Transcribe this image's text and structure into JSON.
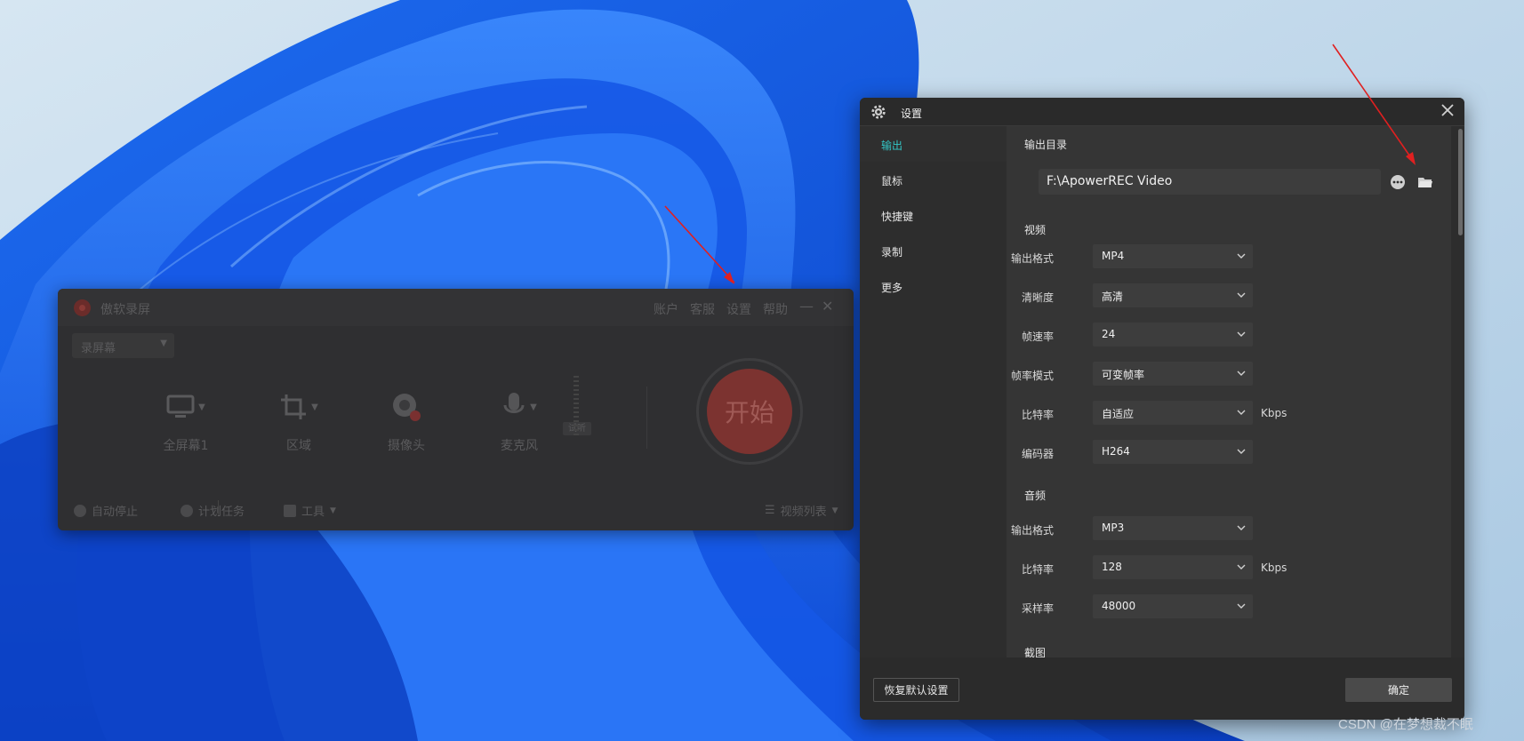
{
  "recorder": {
    "title": "傲软录屏",
    "menu": [
      "账户",
      "客服",
      "设置",
      "帮助"
    ],
    "mode": "录屏幕",
    "sources": [
      {
        "label": "全屏幕1",
        "icon": "monitor-icon"
      },
      {
        "label": "区域",
        "icon": "crop-icon"
      },
      {
        "label": "摄像头",
        "icon": "webcam-icon"
      },
      {
        "label": "麦克风",
        "icon": "microphone-icon"
      }
    ],
    "mic_test": "试听",
    "start": "开始",
    "footer": {
      "auto_stop": "自动停止",
      "schedule": "计划任务",
      "tools": "工具",
      "video_list": "视频列表"
    }
  },
  "settings": {
    "title": "设置",
    "sidebar": [
      "输出",
      "鼠标",
      "快捷键",
      "录制",
      "更多"
    ],
    "active_tab": "输出",
    "output_dir": {
      "label": "输出目录",
      "path": "F:\\ApowerREC Video"
    },
    "video": {
      "label": "视频",
      "format": {
        "label": "输出格式",
        "value": "MP4"
      },
      "quality": {
        "label": "清晰度",
        "value": "高清"
      },
      "fps": {
        "label": "帧速率",
        "value": "24"
      },
      "fps_mode": {
        "label": "帧率模式",
        "value": "可变帧率"
      },
      "bitrate": {
        "label": "比特率",
        "value": "自适应",
        "unit": "Kbps"
      },
      "encoder": {
        "label": "编码器",
        "value": "H264"
      }
    },
    "audio": {
      "label": "音频",
      "format": {
        "label": "输出格式",
        "value": "MP3"
      },
      "bitrate": {
        "label": "比特率",
        "value": "128",
        "unit": "Kbps"
      },
      "sample_rate": {
        "label": "采样率",
        "value": "48000"
      }
    },
    "screenshot": {
      "label": "截图"
    },
    "buttons": {
      "reset": "恢复默认设置",
      "ok": "确定"
    }
  },
  "watermark": "CSDN @在梦想裁不眠",
  "colors": {
    "accent": "#33c6c6",
    "start_button": "#7c3330",
    "arrow": "#e02020"
  }
}
